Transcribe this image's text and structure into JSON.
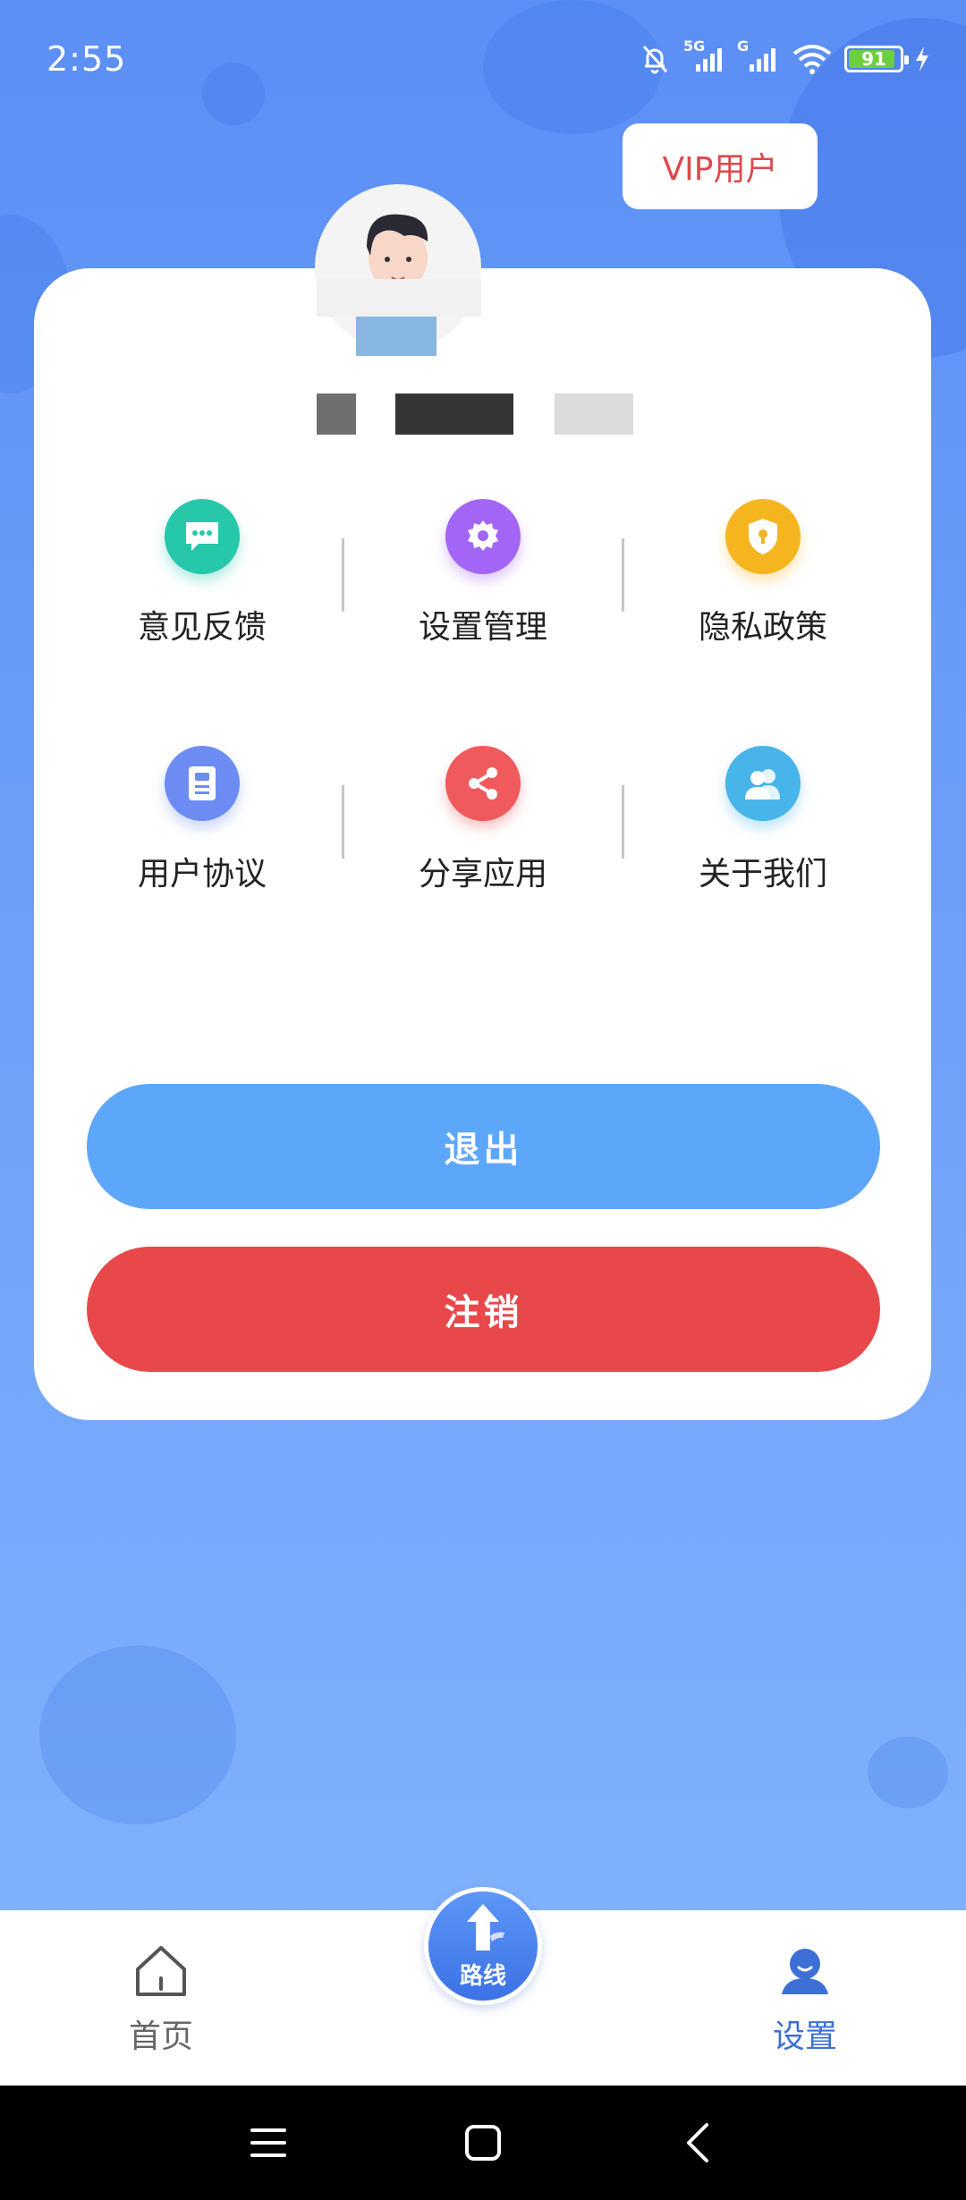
{
  "status_bar": {
    "time": "2:55",
    "network_1": "5G",
    "network_2": "G",
    "battery": "91",
    "battery_level": 0.91
  },
  "vip_label": "VIP用户",
  "grid_items": [
    {
      "label": "意见反馈",
      "icon": "message-dots-icon",
      "color": "#27c7aa"
    },
    {
      "label": "设置管理",
      "icon": "gear-icon",
      "color": "#a365f5"
    },
    {
      "label": "隐私政策",
      "icon": "shield-lock-icon",
      "color": "#f5b51f"
    },
    {
      "label": "用户协议",
      "icon": "document-icon",
      "color": "#6c8cf3"
    },
    {
      "label": "分享应用",
      "icon": "share-icon",
      "color": "#f05a5c"
    },
    {
      "label": "关于我们",
      "icon": "users-icon",
      "color": "#47b4ea"
    }
  ],
  "buttons": {
    "logout": "退出",
    "deregister": "注销"
  },
  "bottom_nav": {
    "home": "首页",
    "route": "路线",
    "settings": "设置"
  },
  "colors": {
    "background_top": "#5b8ff5",
    "background_bottom": "#84b6fc",
    "logout_button": "#5da7fb",
    "deregister_button": "#e8484a",
    "active_tab": "#3d6fd6",
    "vip_text": "#e0474b"
  }
}
